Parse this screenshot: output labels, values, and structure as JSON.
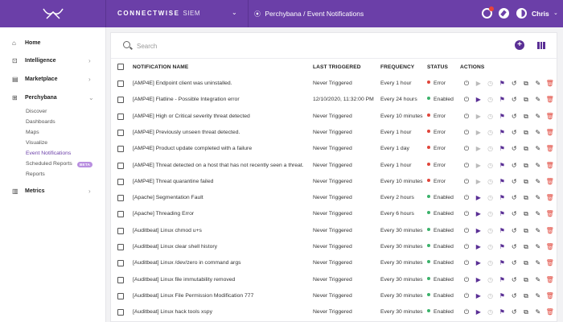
{
  "header": {
    "brand": "CONNECTWISE",
    "brand_suffix": "SIEM",
    "breadcrumb": "Perchybana / Event Notifications",
    "user": "Chris"
  },
  "sidebar": {
    "items": [
      {
        "label": "Home",
        "icon": "home-icon"
      },
      {
        "label": "Intelligence",
        "icon": "intelligence-icon"
      },
      {
        "label": "Marketplace",
        "icon": "marketplace-icon"
      },
      {
        "label": "Perchybana",
        "icon": "perchybana-icon"
      },
      {
        "label": "Metrics",
        "icon": "metrics-icon"
      }
    ],
    "sub_items": [
      "Discover",
      "Dashboards",
      "Maps",
      "Visualize",
      "Event Notifications",
      "Scheduled Reports",
      "Reports"
    ],
    "beta_label": "BETA"
  },
  "search": {
    "placeholder": "Search",
    "value": ""
  },
  "table": {
    "columns": [
      "NOTIFICATION NAME",
      "LAST TRIGGERED",
      "FREQUENCY",
      "STATUS",
      "ACTIONS"
    ],
    "rows": [
      {
        "name": "[AMP4E] Endpoint client was uninstalled.",
        "triggered": "Never Triggered",
        "frequency": "Every 1 hour",
        "status": "Error"
      },
      {
        "name": "[AMP4E] Flatline - Possible Integration error",
        "triggered": "12/10/2020, 11:32:00 PM",
        "frequency": "Every 24 hours",
        "status": "Enabled"
      },
      {
        "name": "[AMP4E] High or Critical severity threat detected",
        "triggered": "Never Triggered",
        "frequency": "Every 10 minutes",
        "status": "Error"
      },
      {
        "name": "[AMP4E] Previously unseen threat detected.",
        "triggered": "Never Triggered",
        "frequency": "Every 1 hour",
        "status": "Error"
      },
      {
        "name": "[AMP4E] Product update completed with a failure",
        "triggered": "Never Triggered",
        "frequency": "Every 1 day",
        "status": "Error"
      },
      {
        "name": "[AMP4E] Threat detected on a host that has not recently seen a threat.",
        "triggered": "Never Triggered",
        "frequency": "Every 1 hour",
        "status": "Error"
      },
      {
        "name": "[AMP4E] Threat quarantine failed",
        "triggered": "Never Triggered",
        "frequency": "Every 10 minutes",
        "status": "Error"
      },
      {
        "name": "[Apache] Segmentation Fault",
        "triggered": "Never Triggered",
        "frequency": "Every 2 hours",
        "status": "Enabled"
      },
      {
        "name": "[Apache] Threading Error",
        "triggered": "Never Triggered",
        "frequency": "Every 6 hours",
        "status": "Enabled"
      },
      {
        "name": "[Auditbeat] Linux chmod u+s",
        "triggered": "Never Triggered",
        "frequency": "Every 30 minutes",
        "status": "Enabled"
      },
      {
        "name": "[Auditbeat] Linux clear shell history",
        "triggered": "Never Triggered",
        "frequency": "Every 30 minutes",
        "status": "Enabled"
      },
      {
        "name": "[Auditbeat] Linux /dev/zero in command args",
        "triggered": "Never Triggered",
        "frequency": "Every 30 minutes",
        "status": "Enabled"
      },
      {
        "name": "[Auditbeat] Linux file immutability removed",
        "triggered": "Never Triggered",
        "frequency": "Every 30 minutes",
        "status": "Enabled"
      },
      {
        "name": "[Auditbeat] Linux File Permission Modification 777",
        "triggered": "Never Triggered",
        "frequency": "Every 30 minutes",
        "status": "Enabled"
      },
      {
        "name": "[Auditbeat] Linux hack tools xspy",
        "triggered": "Never Triggered",
        "frequency": "Every 30 minutes",
        "status": "Enabled"
      }
    ]
  },
  "colors": {
    "brand": "#6b3fa8",
    "status_error": "#e0453a",
    "status_enabled": "#3bb26a"
  }
}
